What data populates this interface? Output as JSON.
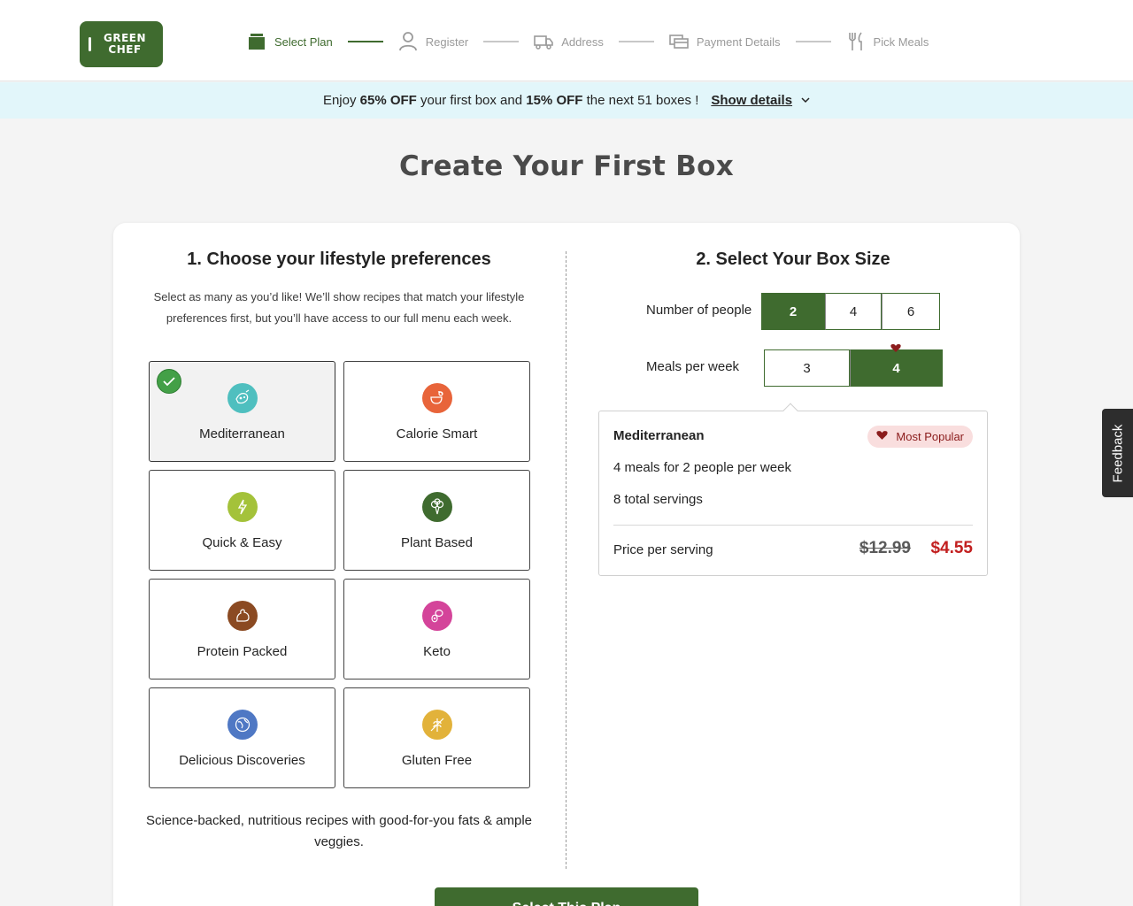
{
  "header": {
    "logo_line1": "GREEN",
    "logo_line2": "CHEF",
    "steps": [
      {
        "label": "Select Plan",
        "icon": "box-icon",
        "active": true
      },
      {
        "label": "Register",
        "icon": "user-icon",
        "active": false
      },
      {
        "label": "Address",
        "icon": "truck-icon",
        "active": false
      },
      {
        "label": "Payment Details",
        "icon": "card-icon",
        "active": false
      },
      {
        "label": "Pick Meals",
        "icon": "fork-knife-icon",
        "active": false
      }
    ]
  },
  "promo": {
    "pre": "Enjoy ",
    "off1": "65% OFF",
    "mid": " your first box and ",
    "off2": "15% OFF",
    "post": " the next 51 boxes !",
    "show_details": "Show details",
    "chevron": "⌄"
  },
  "page_title": "Create Your First Box",
  "left": {
    "title": "1. Choose your lifestyle preferences",
    "description": "Select as many as you’d like! We’ll show recipes that match your lifestyle preferences first, but you’ll have access to our full menu each week.",
    "tiles": [
      {
        "label": "Mediterranean",
        "icon": "mediterranean-icon",
        "color": "#4fbfbf",
        "selected": true
      },
      {
        "label": "Calorie Smart",
        "icon": "calorie-smart-icon",
        "color": "#e8643a",
        "selected": false
      },
      {
        "label": "Quick & Easy",
        "icon": "quick-easy-icon",
        "color": "#a4c23a",
        "selected": false
      },
      {
        "label": "Plant Based",
        "icon": "plant-based-icon",
        "color": "#3f6b2f",
        "selected": false
      },
      {
        "label": "Protein Packed",
        "icon": "protein-packed-icon",
        "color": "#8b4a22",
        "selected": false
      },
      {
        "label": "Keto",
        "icon": "keto-icon",
        "color": "#d4449a",
        "selected": false
      },
      {
        "label": "Delicious Discoveries",
        "icon": "discoveries-icon",
        "color": "#4f78c4",
        "selected": false
      },
      {
        "label": "Gluten Free",
        "icon": "gluten-free-icon",
        "color": "#e2b23a",
        "selected": false
      }
    ],
    "footer": "Science-backed, nutritious recipes with good-for-you fats & ample veggies."
  },
  "right": {
    "title": "2. Select Your Box Size",
    "people_label": "Number of people",
    "people_options": [
      "2",
      "4",
      "6"
    ],
    "people_selected": "2",
    "meals_label": "Meals per week",
    "meals_options": [
      "3",
      "4"
    ],
    "meals_selected": "4",
    "summary": {
      "plan": "Mediterranean",
      "badge": "Most Popular",
      "line1": "4 meals for 2 people per week",
      "line2": "8 total servings",
      "price_label": "Price per serving",
      "old_price": "$12.99",
      "new_price": "$4.55"
    }
  },
  "cta": "Select This Plan",
  "feedback": "Feedback",
  "colors": {
    "brand_green": "#3f6b2f",
    "promo_bg": "#e2f6fa",
    "price_red": "#c21f1f"
  }
}
